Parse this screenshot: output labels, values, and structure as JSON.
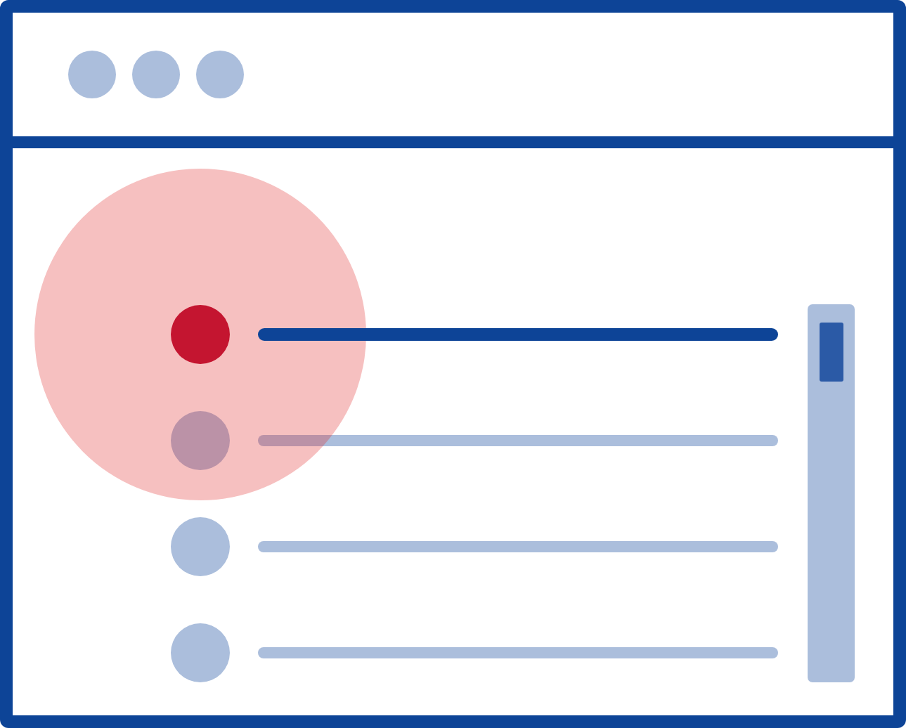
{
  "list": {
    "items": [
      {
        "selected": true
      },
      {
        "selected": false
      },
      {
        "selected": false
      },
      {
        "selected": false
      }
    ]
  }
}
